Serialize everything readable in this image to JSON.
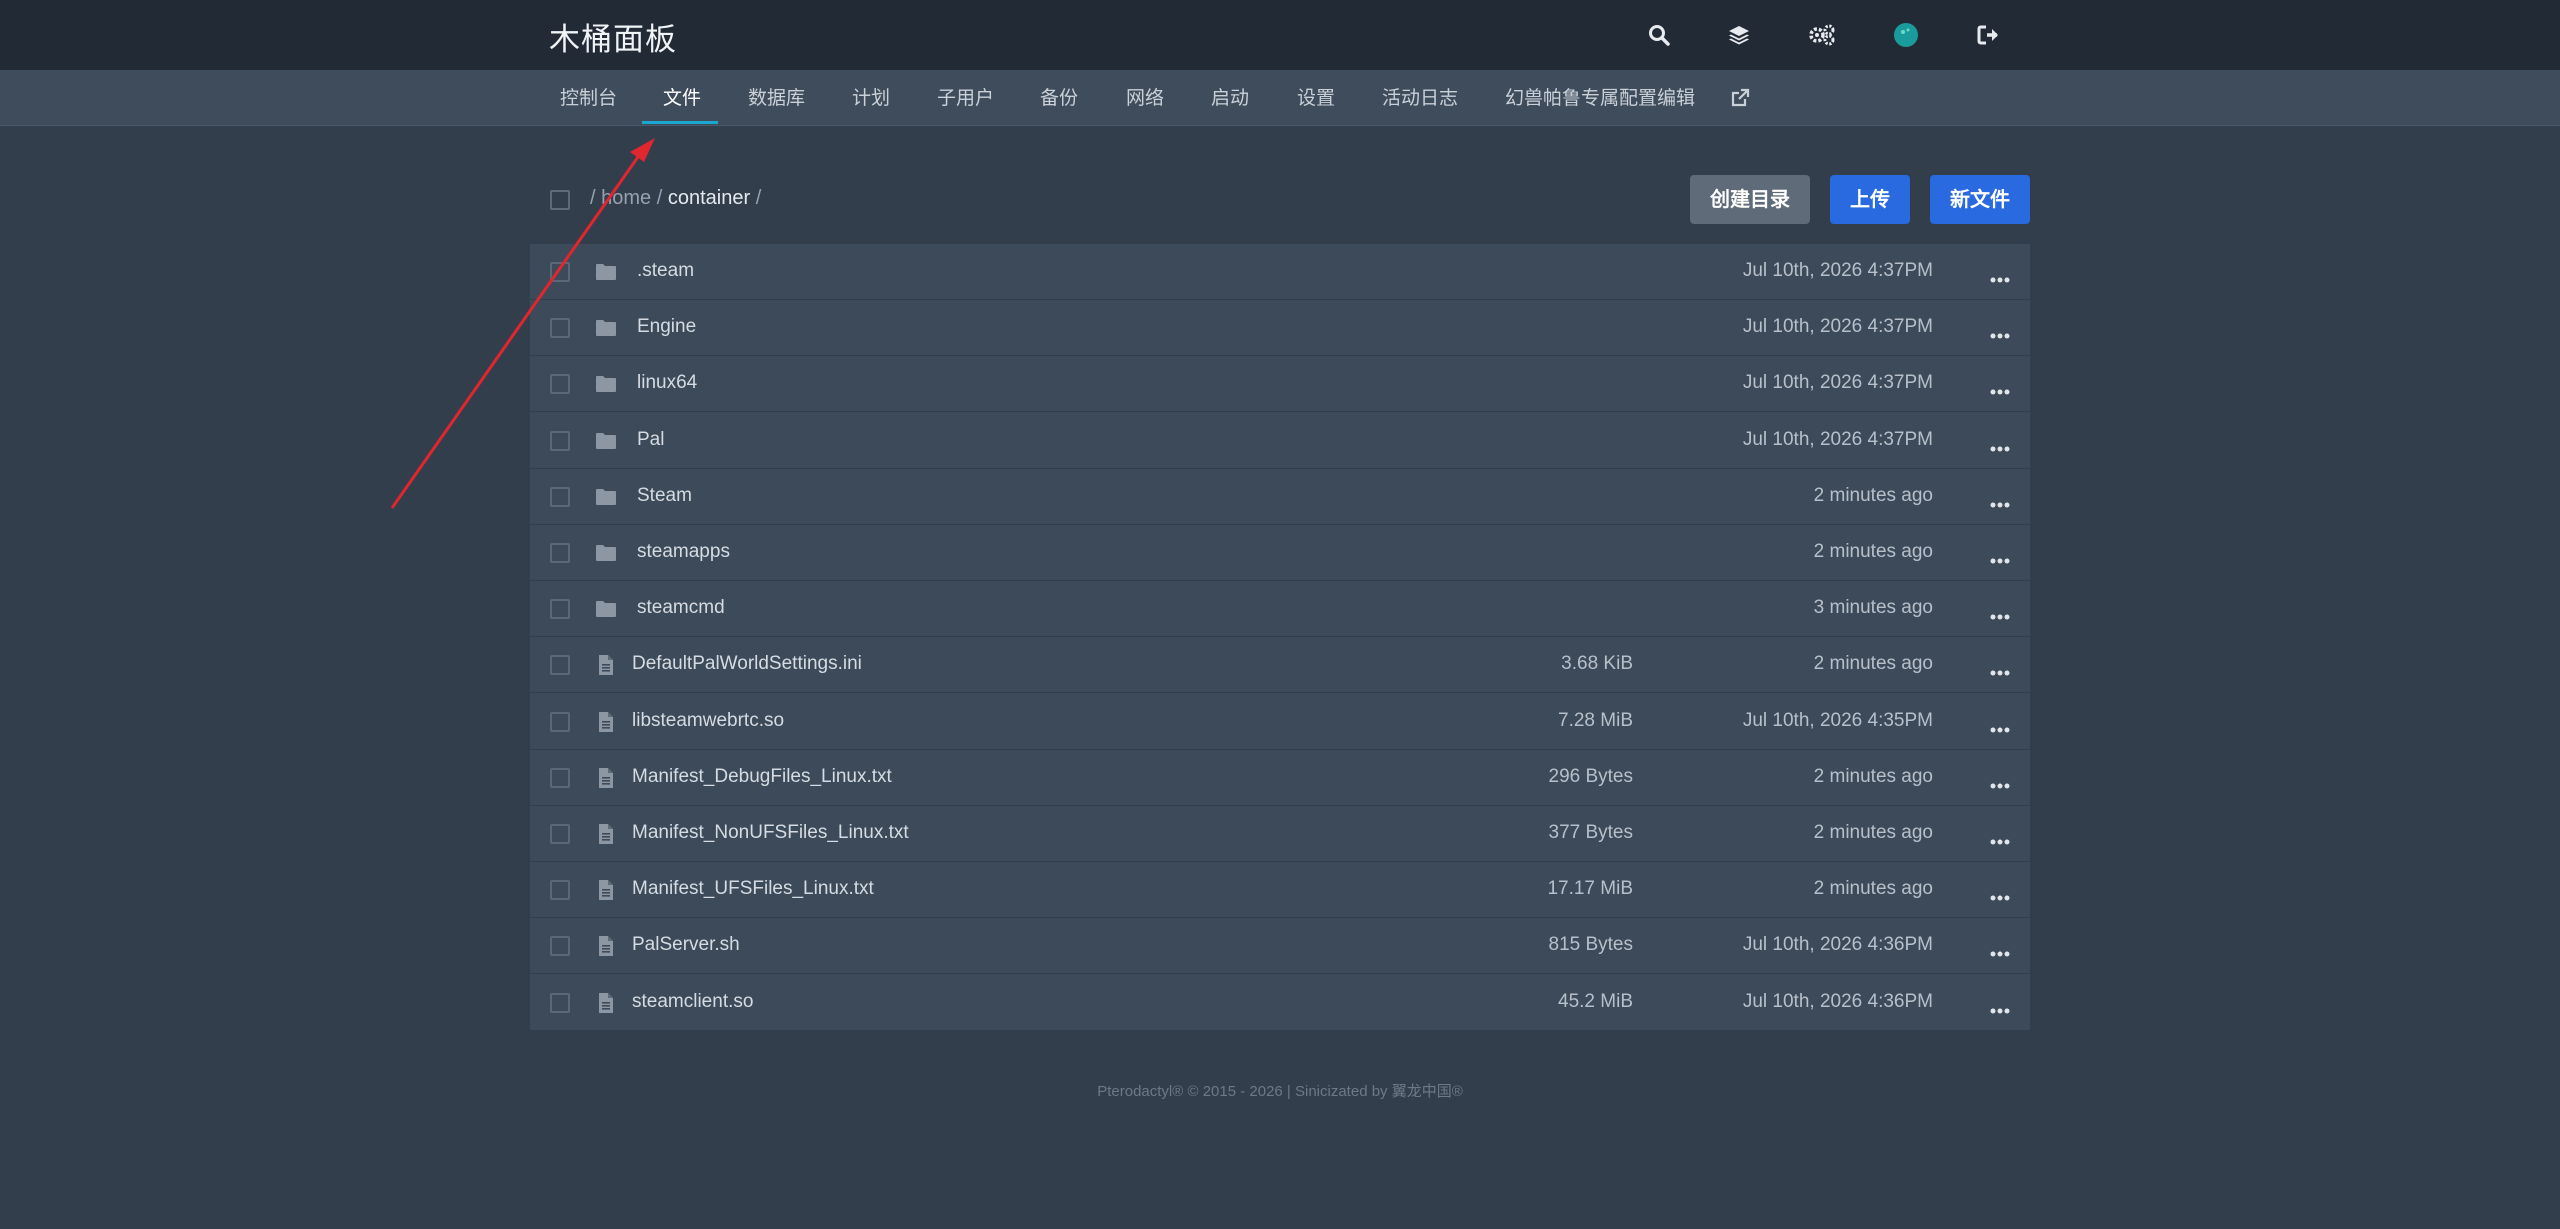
{
  "header": {
    "title": "木桶面板",
    "icons": [
      "search-icon",
      "layers-icon",
      "gears-icon",
      "avatar",
      "logout-icon"
    ]
  },
  "nav": {
    "tabs": [
      {
        "label": "控制台",
        "active": false
      },
      {
        "label": "文件",
        "active": true
      },
      {
        "label": "数据库",
        "active": false
      },
      {
        "label": "计划",
        "active": false
      },
      {
        "label": "子用户",
        "active": false
      },
      {
        "label": "备份",
        "active": false
      },
      {
        "label": "网络",
        "active": false
      },
      {
        "label": "启动",
        "active": false
      },
      {
        "label": "设置",
        "active": false
      },
      {
        "label": "活动日志",
        "active": false
      },
      {
        "label": "幻兽帕鲁专属配置编辑",
        "active": false
      }
    ],
    "external_icon": "external-link-icon"
  },
  "breadcrumb": {
    "sep1": "/",
    "home": "home",
    "sep2": "/",
    "folder": "container",
    "sep3": "/"
  },
  "actions": {
    "create_dir": "创建目录",
    "upload": "上传",
    "new_file": "新文件"
  },
  "files": [
    {
      "name": ".steam",
      "type": "folder",
      "size": "",
      "date": "Jul 10th, 2026 4:37PM"
    },
    {
      "name": "Engine",
      "type": "folder",
      "size": "",
      "date": "Jul 10th, 2026 4:37PM"
    },
    {
      "name": "linux64",
      "type": "folder",
      "size": "",
      "date": "Jul 10th, 2026 4:37PM"
    },
    {
      "name": "Pal",
      "type": "folder",
      "size": "",
      "date": "Jul 10th, 2026 4:37PM"
    },
    {
      "name": "Steam",
      "type": "folder",
      "size": "",
      "date": "2 minutes ago"
    },
    {
      "name": "steamapps",
      "type": "folder",
      "size": "",
      "date": "2 minutes ago"
    },
    {
      "name": "steamcmd",
      "type": "folder",
      "size": "",
      "date": "3 minutes ago"
    },
    {
      "name": "DefaultPalWorldSettings.ini",
      "type": "file",
      "size": "3.68 KiB",
      "date": "2 minutes ago"
    },
    {
      "name": "libsteamwebrtc.so",
      "type": "file",
      "size": "7.28 MiB",
      "date": "Jul 10th, 2026 4:35PM"
    },
    {
      "name": "Manifest_DebugFiles_Linux.txt",
      "type": "file",
      "size": "296 Bytes",
      "date": "2 minutes ago"
    },
    {
      "name": "Manifest_NonUFSFiles_Linux.txt",
      "type": "file",
      "size": "377 Bytes",
      "date": "2 minutes ago"
    },
    {
      "name": "Manifest_UFSFiles_Linux.txt",
      "type": "file",
      "size": "17.17 MiB",
      "date": "2 minutes ago"
    },
    {
      "name": "PalServer.sh",
      "type": "file",
      "size": "815 Bytes",
      "date": "Jul 10th, 2026 4:36PM"
    },
    {
      "name": "steamclient.so",
      "type": "file",
      "size": "45.2 MiB",
      "date": "Jul 10th, 2026 4:36PM"
    }
  ],
  "footer": "Pterodactyl® © 2015 - 2026 | Sinicizated by 翼龙中国®",
  "colors": {
    "accent": "#19a7cf",
    "primary_button": "#2a6ae0",
    "annotation_arrow": "#e0262e"
  }
}
